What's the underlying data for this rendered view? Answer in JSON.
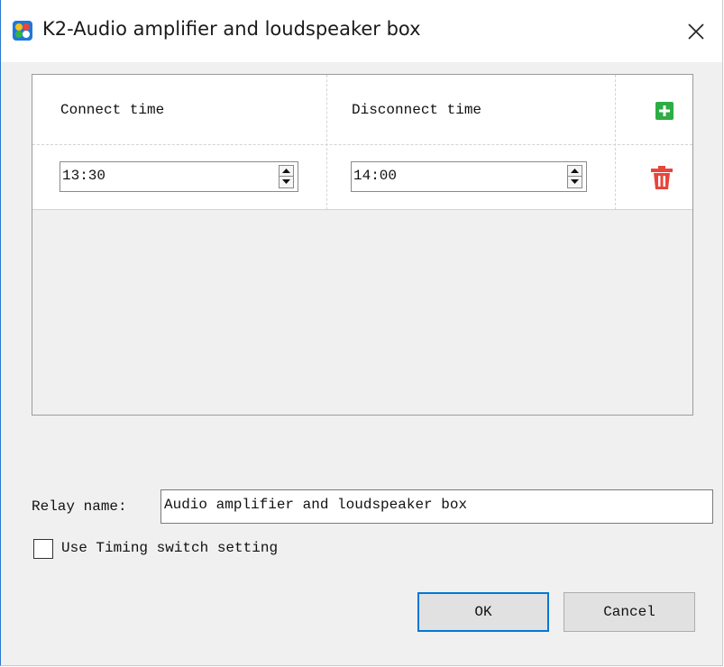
{
  "window": {
    "title": "K2-Audio amplifier and loudspeaker box",
    "app_icon": "app-logo-icon",
    "close_symbol": "close-icon",
    "accent_color": "#0078d7"
  },
  "table": {
    "headers": [
      "Connect time",
      "Disconnect time"
    ],
    "add_icon": "add-row-icon",
    "add_icon_color": "#2eac46",
    "rows": [
      {
        "connect_time": "13:30",
        "disconnect_time": "14:00",
        "delete_icon": "delete-row-icon"
      }
    ],
    "delete_icon_color": "#e8453c"
  },
  "relay": {
    "label": "Relay name:",
    "value": "Audio amplifier and loudspeaker box"
  },
  "timing": {
    "label": "Use Timing switch setting",
    "checked": false
  },
  "buttons": {
    "ok": "OK",
    "cancel": "Cancel"
  }
}
